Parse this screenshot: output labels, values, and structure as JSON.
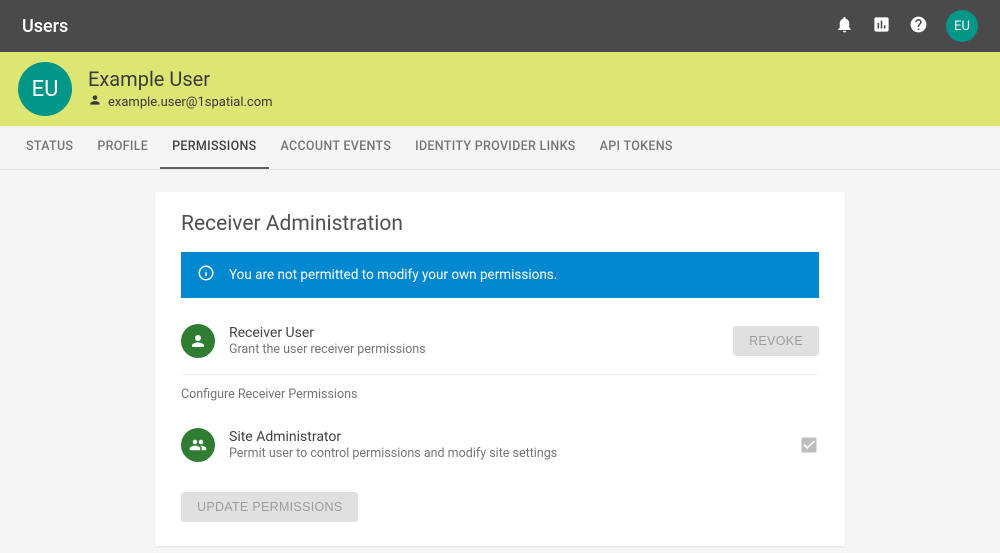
{
  "topbar": {
    "title": "Users",
    "avatar_initials": "EU"
  },
  "user": {
    "initials": "EU",
    "name": "Example User",
    "email": "example.user@1spatial.com"
  },
  "tabs": [
    {
      "label": "STATUS"
    },
    {
      "label": "PROFILE"
    },
    {
      "label": "PERMISSIONS",
      "active": true
    },
    {
      "label": "ACCOUNT EVENTS"
    },
    {
      "label": "IDENTITY PROVIDER LINKS"
    },
    {
      "label": "API TOKENS"
    }
  ],
  "card": {
    "title": "Receiver Administration",
    "alert": "You are not permitted to modify your own permissions.",
    "permission": {
      "name": "Receiver User",
      "desc": "Grant the user receiver permissions",
      "revoke_label": "REVOKE"
    },
    "configure_heading": "Configure Receiver Permissions",
    "sub_permission": {
      "name": "Site Administrator",
      "desc": "Permit user to control permissions and modify site settings"
    },
    "update_label": "UPDATE PERMISSIONS"
  }
}
